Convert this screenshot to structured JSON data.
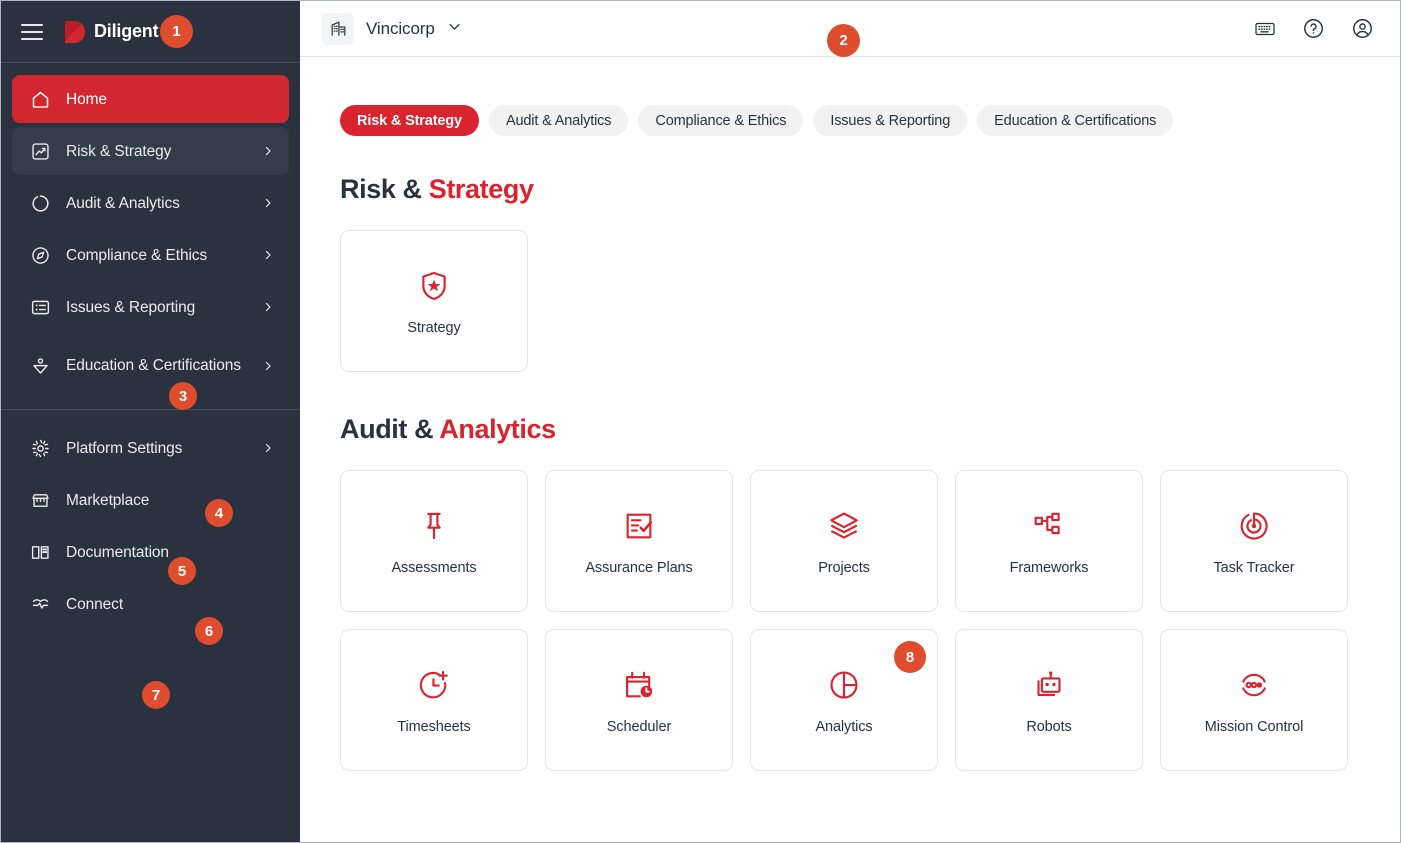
{
  "colors": {
    "brand_red": "#d22730",
    "accent_red": "#d9232e",
    "sidebar_bg": "#2a323f",
    "badge_orange": "#de4d2e",
    "text_dark": "#2a323f"
  },
  "sidebar": {
    "brand_name": "Diligent",
    "menu_icon": "hamburger-icon",
    "logo_icon": "diligent-logo-icon",
    "primary_items": [
      {
        "label": "Home",
        "icon": "home-icon",
        "state": "active",
        "chevron": false
      },
      {
        "label": "Risk & Strategy",
        "icon": "chart-line-icon",
        "state": "hover",
        "chevron": true
      },
      {
        "label": "Audit & Analytics",
        "icon": "circle-dashed-icon",
        "state": "default",
        "chevron": true
      },
      {
        "label": "Compliance & Ethics",
        "icon": "compass-icon",
        "state": "default",
        "chevron": true
      },
      {
        "label": "Issues & Reporting",
        "icon": "list-box-icon",
        "state": "default",
        "chevron": true
      },
      {
        "label": "Education & Certifications",
        "icon": "graduation-icon",
        "state": "default",
        "chevron": true
      }
    ],
    "secondary_items": [
      {
        "label": "Platform Settings",
        "icon": "gear-icon",
        "chevron": true
      },
      {
        "label": "Marketplace",
        "icon": "store-icon",
        "chevron": false
      },
      {
        "label": "Documentation",
        "icon": "book-icon",
        "chevron": false
      },
      {
        "label": "Connect",
        "icon": "connect-pulse-icon",
        "chevron": false
      }
    ]
  },
  "topbar": {
    "org_name": "Vincicorp",
    "org_icon": "building-icon",
    "chevron_icon": "chevron-down-icon",
    "actions": [
      {
        "name": "keyboard-shortcuts-icon",
        "label": "Keyboard shortcuts"
      },
      {
        "name": "help-icon",
        "label": "Help"
      },
      {
        "name": "account-icon",
        "label": "Account"
      }
    ]
  },
  "tabs": [
    {
      "label": "Risk & Strategy",
      "active": true
    },
    {
      "label": "Audit & Analytics",
      "active": false
    },
    {
      "label": "Compliance & Ethics",
      "active": false
    },
    {
      "label": "Issues & Reporting",
      "active": false
    },
    {
      "label": "Education & Certifications",
      "active": false
    }
  ],
  "sections": [
    {
      "title_prefix": "Risk & ",
      "title_accent": "Strategy",
      "cards": [
        {
          "label": "Strategy",
          "icon": "shield-star-icon"
        }
      ]
    },
    {
      "title_prefix": "Audit & ",
      "title_accent": "Analytics",
      "cards": [
        {
          "label": "Assessments",
          "icon": "pin-icon"
        },
        {
          "label": "Assurance Plans",
          "icon": "checklist-icon"
        },
        {
          "label": "Projects",
          "icon": "layers-icon"
        },
        {
          "label": "Frameworks",
          "icon": "hierarchy-icon"
        },
        {
          "label": "Task Tracker",
          "icon": "radar-target-icon"
        },
        {
          "label": "Timesheets",
          "icon": "clock-plus-icon"
        },
        {
          "label": "Scheduler",
          "icon": "calendar-clock-icon"
        },
        {
          "label": "Analytics",
          "icon": "pie-chart-icon"
        },
        {
          "label": "Robots",
          "icon": "robot-icon"
        },
        {
          "label": "Mission Control",
          "icon": "mission-control-icon"
        }
      ]
    }
  ],
  "badges": [
    {
      "id": 1,
      "value": "1",
      "anchor": "diligent-logo"
    },
    {
      "id": 2,
      "value": "2",
      "anchor": "org-selector"
    },
    {
      "id": 3,
      "value": "3",
      "anchor": "sidebar-education-certifications"
    },
    {
      "id": 4,
      "value": "4",
      "anchor": "sidebar-platform-settings"
    },
    {
      "id": 5,
      "value": "5",
      "anchor": "sidebar-marketplace"
    },
    {
      "id": 6,
      "value": "6",
      "anchor": "sidebar-documentation"
    },
    {
      "id": 7,
      "value": "7",
      "anchor": "sidebar-connect"
    },
    {
      "id": 8,
      "value": "8",
      "anchor": "card-analytics"
    }
  ]
}
